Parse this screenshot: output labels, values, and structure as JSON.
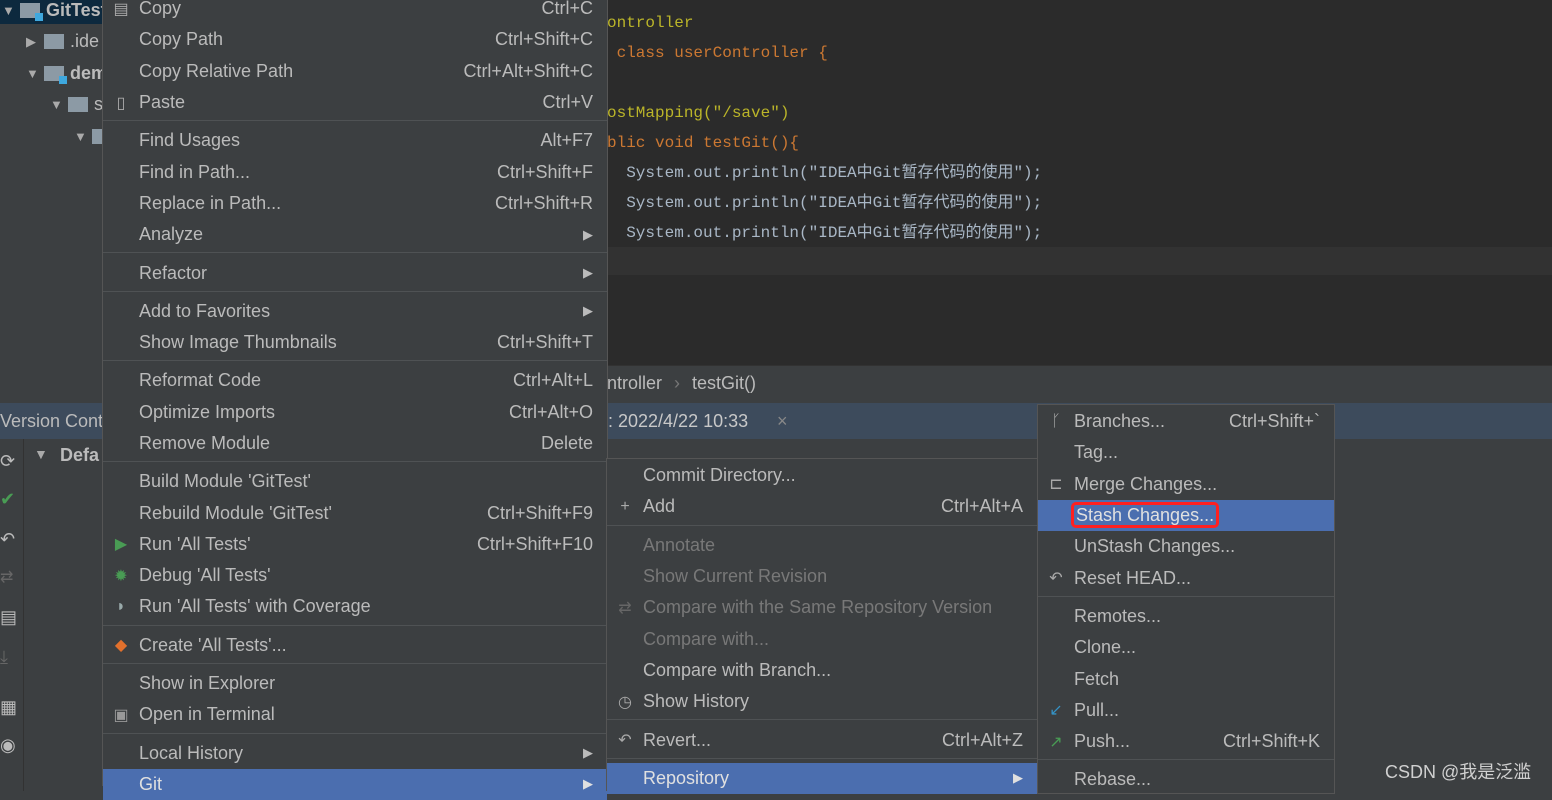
{
  "tree": {
    "items": [
      {
        "label": "GitTest",
        "top": 0,
        "indent": 0,
        "tri": "▼",
        "mod": true,
        "selected": true
      },
      {
        "label": ".ide",
        "indent": 1,
        "tri": "▶",
        "mod": false
      },
      {
        "label": "dem",
        "indent": 1,
        "tri": "▼",
        "mod": true
      },
      {
        "label": "s",
        "indent": 2,
        "tri": "▼",
        "mod": false
      },
      {
        "label": "",
        "indent": 3,
        "tri": "▼",
        "mod": false
      }
    ]
  },
  "editor": {
    "lines": [
      {
        "text": "ontroller",
        "color": "#bbb529"
      },
      {
        "text": " class userController {",
        "color": "#cc7832"
      },
      {
        "text": "",
        "color": "#a9b7c6"
      },
      {
        "text": "ostMapping(\"/save\")",
        "color": "#bbb529"
      },
      {
        "text": "blic void testGit(){",
        "color": "#cc7832"
      },
      {
        "text": "  System.out.println(\"IDEA中Git暂存代码的使用\");",
        "color": "#a9b7c6"
      },
      {
        "text": "  System.out.println(\"IDEA中Git暂存代码的使用\");",
        "color": "#a9b7c6"
      },
      {
        "text": "  System.out.println(\"IDEA中Git暂存代码的使用\");",
        "color": "#a9b7c6"
      }
    ]
  },
  "breadcrumb": [
    "ntroller",
    "testGit()"
  ],
  "version_control": {
    "title": "Version Cont",
    "tab": ": 2022/4/22 10:33",
    "tab_close": "×",
    "changelist": "Defa"
  },
  "context_menu": [
    {
      "label": "Copy",
      "shortcut": "Ctrl+C",
      "icon": "copy-icon",
      "glyph": "▤"
    },
    {
      "label": "Copy Path",
      "shortcut": "Ctrl+Shift+C"
    },
    {
      "label": "Copy Relative Path",
      "shortcut": "Ctrl+Alt+Shift+C"
    },
    {
      "label": "Paste",
      "shortcut": "Ctrl+V",
      "icon": "paste-icon",
      "glyph": "▯"
    },
    {
      "sep": true
    },
    {
      "label": "Find Usages",
      "shortcut": "Alt+F7"
    },
    {
      "label": "Find in Path...",
      "shortcut": "Ctrl+Shift+F"
    },
    {
      "label": "Replace in Path...",
      "shortcut": "Ctrl+Shift+R"
    },
    {
      "label": "Analyze",
      "submenu": true
    },
    {
      "sep": true
    },
    {
      "label": "Refactor",
      "submenu": true
    },
    {
      "sep": true
    },
    {
      "label": "Add to Favorites",
      "submenu": true
    },
    {
      "label": "Show Image Thumbnails",
      "shortcut": "Ctrl+Shift+T"
    },
    {
      "sep": true
    },
    {
      "label": "Reformat Code",
      "shortcut": "Ctrl+Alt+L"
    },
    {
      "label": "Optimize Imports",
      "shortcut": "Ctrl+Alt+O"
    },
    {
      "label": "Remove Module",
      "shortcut": "Delete"
    },
    {
      "sep": true
    },
    {
      "label": "Build Module 'GitTest'"
    },
    {
      "label": "Rebuild Module 'GitTest'",
      "shortcut": "Ctrl+Shift+F9"
    },
    {
      "label": "Run 'All Tests'",
      "shortcut": "Ctrl+Shift+F10",
      "icon": "run-icon",
      "glyph": "▶",
      "color": "#499c54"
    },
    {
      "label": "Debug 'All Tests'",
      "icon": "debug-icon",
      "glyph": "✹",
      "color": "#499c54"
    },
    {
      "label": "Run 'All Tests' with Coverage",
      "icon": "coverage-icon",
      "glyph": "◗",
      "color": "#9aa"
    },
    {
      "sep": true
    },
    {
      "label": "Create 'All Tests'...",
      "icon": "create-test-icon",
      "glyph": "◆",
      "color": "#e2702c"
    },
    {
      "sep": true
    },
    {
      "label": "Show in Explorer"
    },
    {
      "label": "Open in Terminal",
      "icon": "terminal-icon",
      "glyph": "▣",
      "color": "#999"
    },
    {
      "sep": true
    },
    {
      "label": "Local History",
      "submenu": true
    },
    {
      "label": "Git",
      "submenu": true,
      "selected": true
    }
  ],
  "git_menu": [
    {
      "label": "Commit Directory..."
    },
    {
      "label": "Add",
      "shortcut": "Ctrl+Alt+A",
      "icon": "plus-icon",
      "glyph": "+"
    },
    {
      "sep": true
    },
    {
      "label": "Annotate",
      "disabled": true
    },
    {
      "label": "Show Current Revision",
      "disabled": true
    },
    {
      "label": "Compare with the Same Repository Version",
      "disabled": true,
      "icon": "compare-icon",
      "glyph": "⇄",
      "color": "#666"
    },
    {
      "label": "Compare with...",
      "disabled": true
    },
    {
      "label": "Compare with Branch..."
    },
    {
      "label": "Show History",
      "icon": "clock-icon",
      "glyph": "◷"
    },
    {
      "sep": true
    },
    {
      "label": "Revert...",
      "shortcut": "Ctrl+Alt+Z",
      "icon": "revert-icon",
      "glyph": "↶"
    },
    {
      "sep": true
    },
    {
      "label": "Repository",
      "submenu": true,
      "selected": true
    }
  ],
  "repository_menu": [
    {
      "label": "Branches...",
      "shortcut": "Ctrl+Shift+`",
      "icon": "branch-icon",
      "glyph": "ᚴ"
    },
    {
      "label": "Tag..."
    },
    {
      "label": "Merge Changes...",
      "icon": "merge-icon",
      "glyph": "⊏"
    },
    {
      "label": "Stash Changes...",
      "selected": true,
      "highlighted": true
    },
    {
      "label": "UnStash Changes..."
    },
    {
      "label": "Reset HEAD...",
      "icon": "reset-icon",
      "glyph": "↶"
    },
    {
      "sep": true
    },
    {
      "label": "Remotes..."
    },
    {
      "label": "Clone..."
    },
    {
      "label": "Fetch"
    },
    {
      "label": "Pull...",
      "icon": "pull-icon",
      "glyph": "↙",
      "color": "#3592c4"
    },
    {
      "label": "Push...",
      "shortcut": "Ctrl+Shift+K",
      "icon": "push-icon",
      "glyph": "↗",
      "color": "#499c54"
    },
    {
      "sep": true
    },
    {
      "label": "Rebase..."
    }
  ],
  "colors": {
    "selection": "#4b6eaf",
    "highlight_box": "#ff2020",
    "menu_bg": "#3c3f41",
    "editor_bg": "#2b2b2b"
  },
  "watermark": "CSDN @我是泛滥"
}
